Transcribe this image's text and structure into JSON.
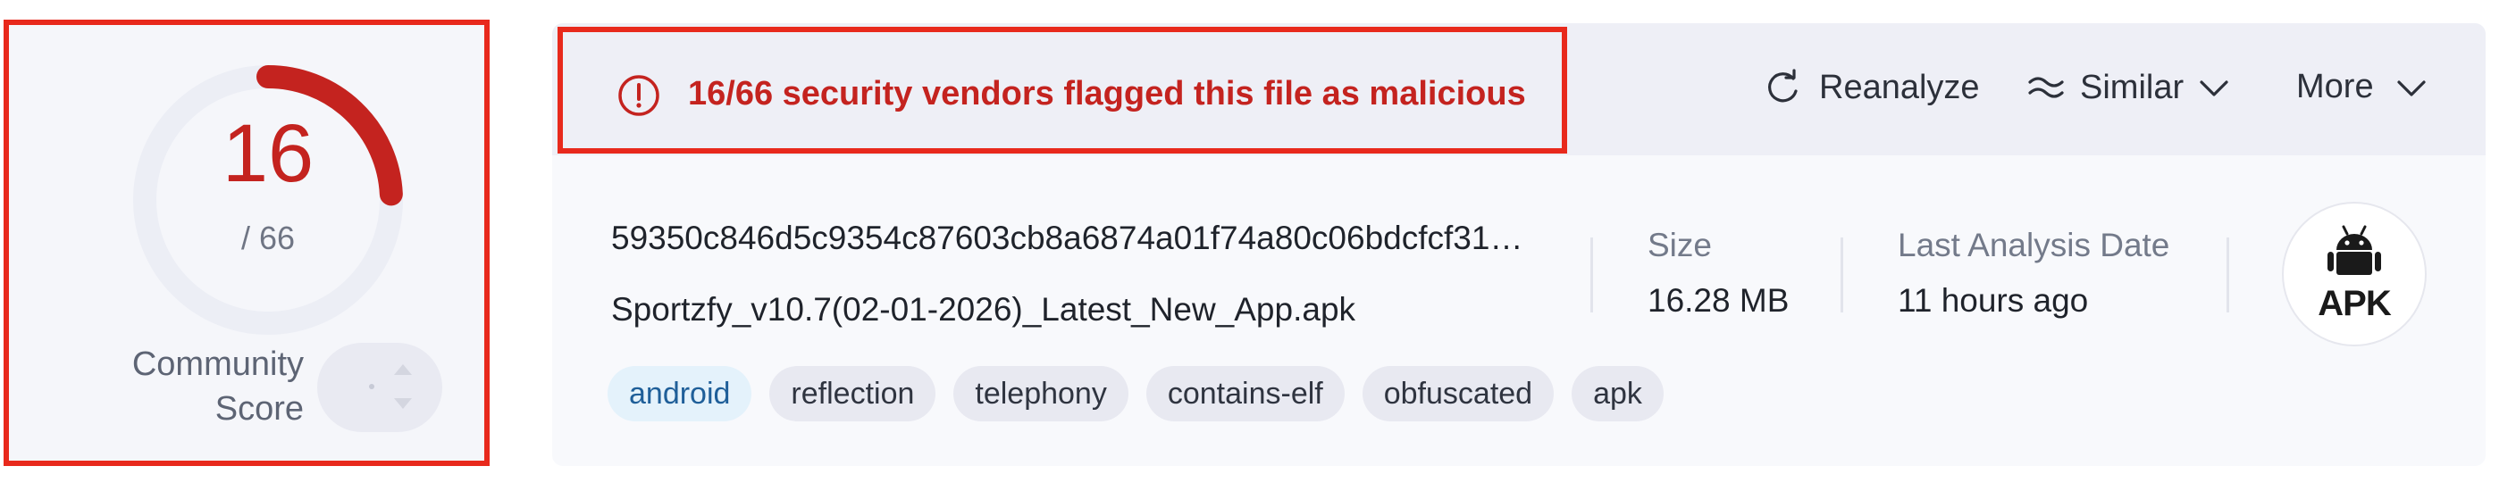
{
  "score": {
    "detections": "16",
    "total": "/ 66",
    "detection_ratio": 0.2424,
    "community_label_line1": "Community",
    "community_label_line2": "Score",
    "ring_color": "#c4231f",
    "ring_track_color": "#eceef5"
  },
  "alert": {
    "icon": "alert-circle-icon",
    "text": "16/66 security vendors flagged this file as malicious",
    "color": "#c4231f"
  },
  "actions": {
    "reanalyze": {
      "icon": "refresh-icon",
      "label": "Reanalyze"
    },
    "similar": {
      "icon": "similar-icon",
      "label": "Similar",
      "caret": "chevron-down-icon"
    },
    "more": {
      "label": "More",
      "caret": "chevron-down-icon"
    }
  },
  "file": {
    "hash": "59350c846d5c9354c87603cb8a6874a01f74a80c06bdcfcf31…",
    "name": "Sportzfy_v10.7(02-01-2026)_Latest_New_App.apk"
  },
  "meta": {
    "size_label": "Size",
    "size_value": "16.28 MB",
    "date_label": "Last Analysis Date",
    "date_value": "11 hours ago"
  },
  "file_type_badge": {
    "icon": "android-icon",
    "text": "APK"
  },
  "tags": [
    "android",
    "reflection",
    "telephony",
    "contains-elf",
    "obfuscated",
    "apk"
  ],
  "highlight_color": "#e8291c"
}
